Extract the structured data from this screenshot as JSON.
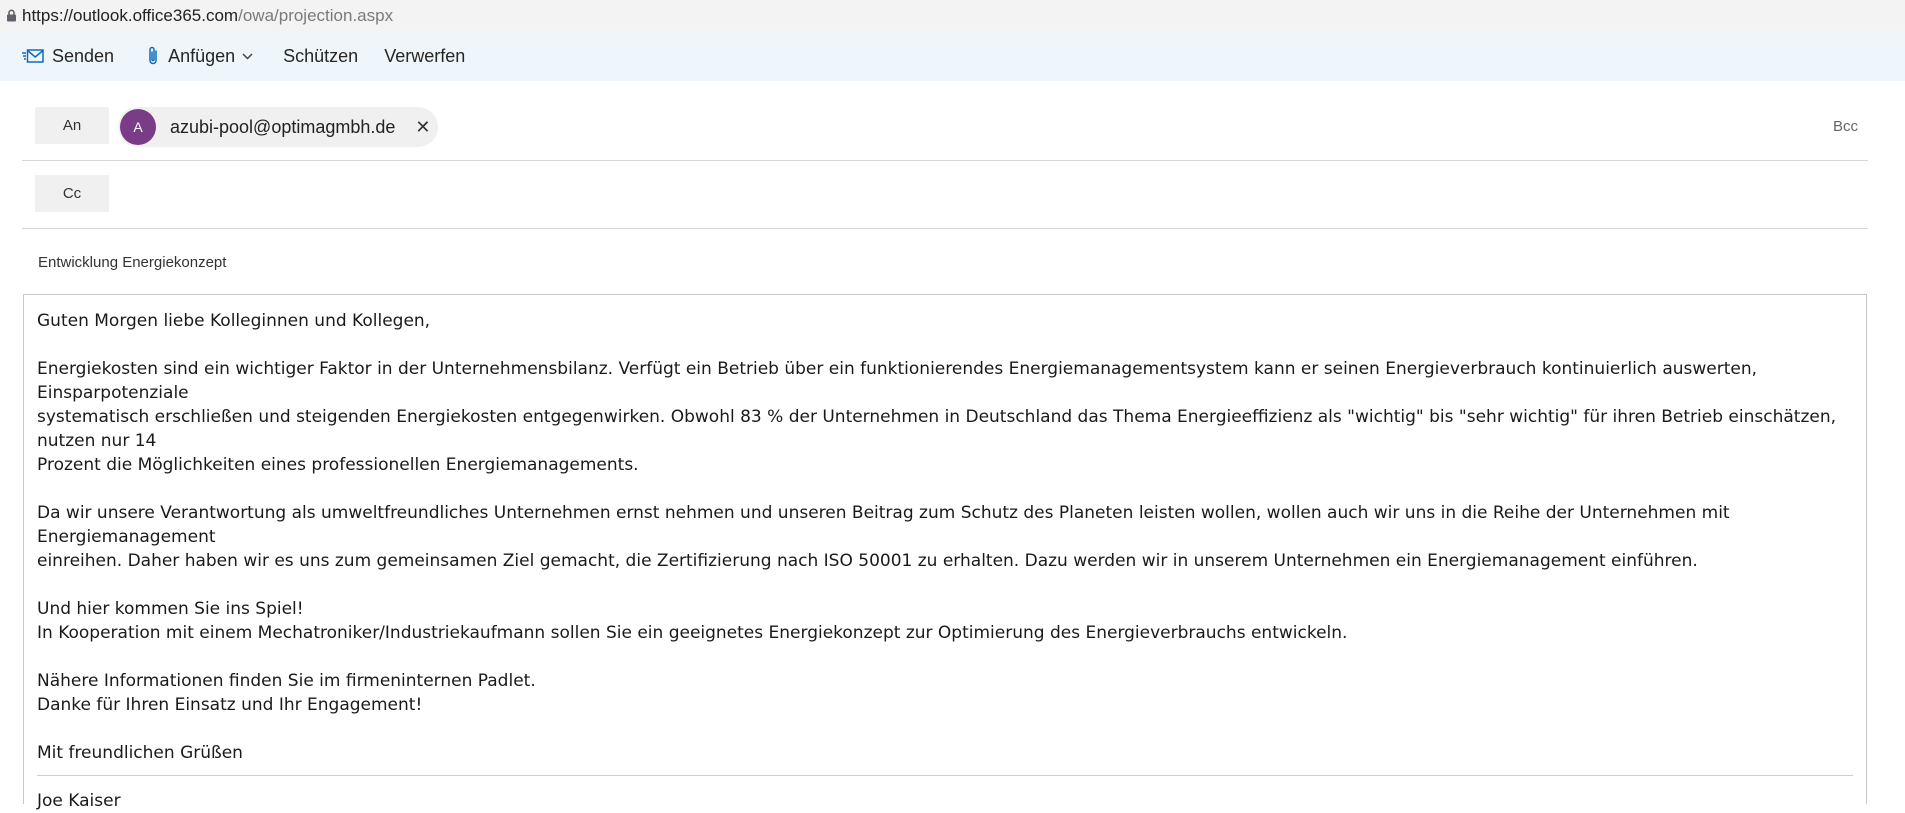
{
  "address_bar": {
    "url_host": "https://outlook.office365.com",
    "url_path": "/owa/projection.aspx"
  },
  "toolbar": {
    "send_label": "Senden",
    "attach_label": "Anfügen",
    "protect_label": "Schützen",
    "discard_label": "Verwerfen"
  },
  "recipients": {
    "to_label": "An",
    "cc_label": "Cc",
    "bcc_label": "Bcc",
    "to_chip": {
      "initial": "A",
      "email": "azubi-pool@optimagmbh.de",
      "avatar_color": "#7a3b87"
    }
  },
  "subject": "Entwicklung Energiekonzept",
  "body": {
    "lines": [
      "Guten Morgen liebe Kolleginnen und Kollegen,",
      "",
      "Energiekosten sind ein wichtiger Faktor in der Unternehmensbilanz. Verfügt ein Betrieb über ein funktionierendes Energiemanagementsystem kann er seinen Energieverbrauch kontinuierlich auswerten, Einsparpotenziale",
      "systematisch erschließen und steigenden Energiekosten entgegenwirken. Obwohl 83 % der Unternehmen in Deutschland das Thema Energieeffizienz als \"wichtig\" bis \"sehr wichtig\" für ihren Betrieb einschätzen, nutzen nur 14",
      "Prozent die Möglichkeiten eines professionellen Energiemanagements.",
      "",
      "Da wir unsere Verantwortung als umweltfreundliches Unternehmen ernst nehmen und unseren Beitrag zum Schutz des Planeten leisten wollen, wollen auch wir uns in die Reihe der Unternehmen mit Energiemanagement",
      "einreihen. Daher haben wir es uns zum gemeinsamen Ziel gemacht, die Zertifizierung nach ISO 50001 zu erhalten. Dazu werden wir in unserem Unternehmen ein Energiemanagement einführen.",
      "",
      "Und hier kommen Sie ins Spiel!",
      "In Kooperation mit einem Mechatroniker/Industriekaufmann sollen Sie ein geeignetes Energiekonzept zur Optimierung des Energieverbrauchs entwickeln.",
      "",
      "Nähere Informationen finden Sie im firmeninternen Padlet.",
      "Danke für Ihren Einsatz und Ihr Engagement!",
      "",
      "Mit freundlichen Grüßen",
      "",
      "Joe Kaiser"
    ]
  },
  "colors": {
    "toolbar_bg": "#eef5fb",
    "send_icon": "#0f6cbd",
    "attach_icon": "#0f6cbd"
  }
}
